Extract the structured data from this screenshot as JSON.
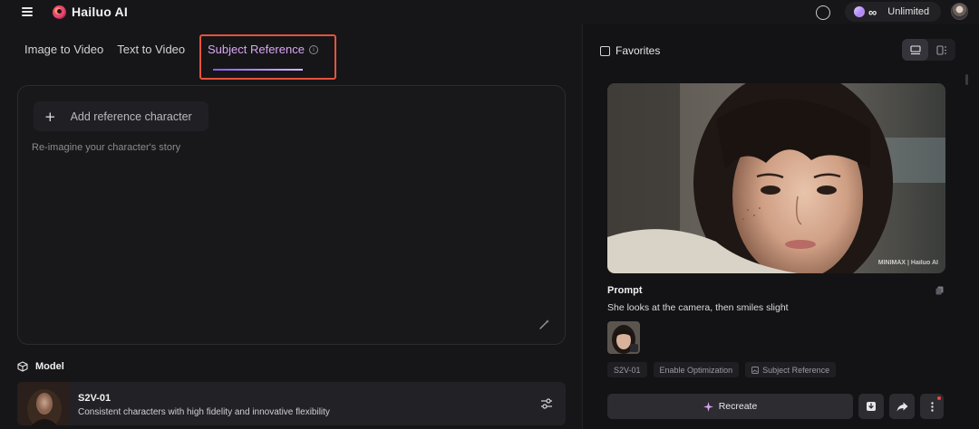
{
  "app": {
    "name": "Hailuo AI"
  },
  "topbar": {
    "plan_label": "Unlimited",
    "infinity_symbol": "∞"
  },
  "tabs": [
    {
      "label": "Image to Video",
      "active": false
    },
    {
      "label": "Text to Video",
      "active": false
    },
    {
      "label": "Subject Reference",
      "active": true
    }
  ],
  "composer": {
    "add_reference_label": "Add reference character",
    "placeholder": "Re-imagine your character's story"
  },
  "model": {
    "section_title": "Model",
    "name": "S2V-01",
    "description": "Consistent characters with high fidelity and innovative flexibility"
  },
  "right": {
    "favorites_label": "Favorites",
    "watermark": "MINIMAX | Hailuo AI",
    "prompt_label": "Prompt",
    "prompt_text": "She looks at the camera, then smiles slight",
    "tags": [
      "S2V-01",
      "Enable Optimization",
      "Subject Reference"
    ],
    "recreate_label": "Recreate"
  },
  "colors": {
    "accent_active_tab": "#d9a6f2",
    "highlight_box": "#e5533d",
    "notification_dot": "#ef4444"
  }
}
